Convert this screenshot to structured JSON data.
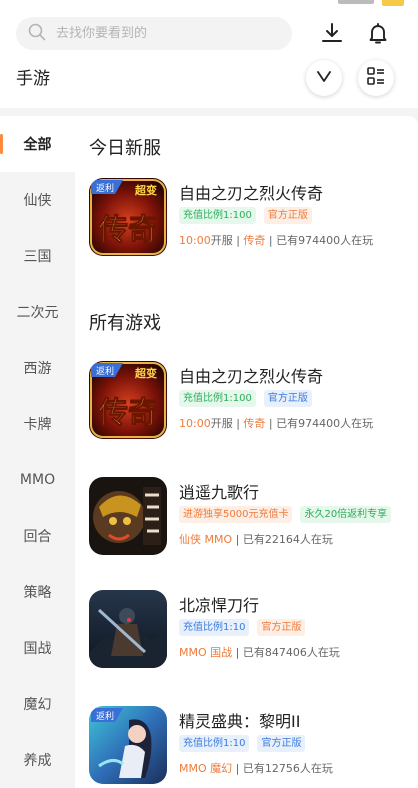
{
  "search": {
    "placeholder": "去找你要看到的"
  },
  "header": {
    "title": "手游"
  },
  "sidebar": {
    "items": [
      {
        "label": "全部",
        "active": true
      },
      {
        "label": "仙侠"
      },
      {
        "label": "三国"
      },
      {
        "label": "二次元"
      },
      {
        "label": "西游"
      },
      {
        "label": "卡牌"
      },
      {
        "label": "MMO"
      },
      {
        "label": "回合"
      },
      {
        "label": "策略"
      },
      {
        "label": "国战"
      },
      {
        "label": "魔幻"
      },
      {
        "label": "养成"
      }
    ]
  },
  "today": {
    "title": "今日新服",
    "game": {
      "name": "自由之刃之烈火传奇",
      "icon": "legend-game-icon",
      "tags": [
        "充值比例1:100",
        "官方正版"
      ],
      "time": "10:00",
      "server": "开服",
      "genre": "传奇",
      "players": "已有974400人在玩"
    }
  },
  "all": {
    "title": "所有游戏",
    "games": [
      {
        "name": "自由之刃之烈火传奇",
        "icon": "legend-game-icon",
        "tags": [
          "充值比例1:100",
          "官方正版"
        ],
        "time": "10:00",
        "server": "开服",
        "genre": "传奇",
        "players": "已有974400人在玩"
      },
      {
        "name": "逍遥九歌行",
        "icon": "monkey-king-icon",
        "tags": [
          "进游独享5000元充值卡",
          "永久20倍返利专享"
        ],
        "genre1": "仙侠",
        "genre2": "MMO",
        "players": "已有22164人在玩"
      },
      {
        "name": "北凉悍刀行",
        "icon": "warrior-icon",
        "tags": [
          "充值比例1:10",
          "官方正版"
        ],
        "genre1": "MMO",
        "genre2": "国战",
        "players": "已有847406人在玩"
      },
      {
        "name": "精灵盛典：黎明II",
        "icon": "fairy-icon",
        "tags": [
          "充值比例1:10",
          "官方正版"
        ],
        "genre1": "MMO",
        "genre2": "魔幻",
        "players": "已有12756人在玩"
      }
    ]
  },
  "badges": {
    "rebate": "返利",
    "super": "超变",
    "legend": "传奇"
  },
  "colors": {
    "accent": "#ff8a3d",
    "green": "#2dae5a",
    "orange": "#ef7a3a",
    "blue": "#3c7ae0"
  }
}
